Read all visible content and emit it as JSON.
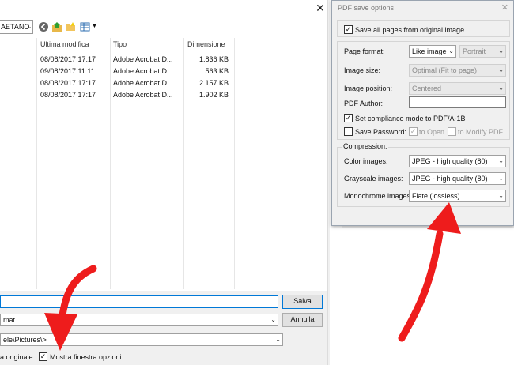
{
  "save_dialog": {
    "close_glyph": "✕",
    "look_in_value": "AETANO",
    "columns": [
      "Ultima modifica",
      "Tipo",
      "Dimensione"
    ],
    "files": [
      {
        "modified": "08/08/2017 17:17",
        "type": "Adobe Acrobat D...",
        "size": "1.836 KB"
      },
      {
        "modified": "09/08/2017 11:11",
        "type": "Adobe Acrobat D...",
        "size": "563 KB"
      },
      {
        "modified": "08/08/2017 17:17",
        "type": "Adobe Acrobat D...",
        "size": "2.157 KB"
      },
      {
        "modified": "08/08/2017 17:17",
        "type": "Adobe Acrobat D...",
        "size": "1.902 KB"
      }
    ],
    "filename_value": "",
    "save_label": "Salva",
    "format_value": "mat",
    "cancel_label": "Annulla",
    "folder_value": "ele\\Pictures\\>",
    "keep_original_label": "a originale",
    "show_options_label": "Mostra finestra opzioni",
    "show_options_checked": true
  },
  "pdf_options": {
    "title": "PDF save options",
    "save_all_pages_label": "Save all pages from original image",
    "save_all_pages_checked": true,
    "page_format_label": "Page format:",
    "page_format_value": "Like image",
    "orientation_value": "Portrait",
    "image_size_label": "Image size:",
    "image_size_value": "Optimal (Fit to page)",
    "image_position_label": "Image position:",
    "image_position_value": "Centered",
    "pdf_author_label": "PDF Author:",
    "pdf_author_value": "",
    "compliance_label": "Set compliance mode to PDF/A-1B",
    "compliance_checked": true,
    "save_password_label": "Save Password:",
    "save_password_checked": false,
    "to_open_label": "to Open",
    "to_modify_label": "to Modify",
    "pdf_suffix": "PDF",
    "compression_label": "Compression:",
    "color_images_label": "Color images:",
    "color_images_value": "JPEG - high quality (80)",
    "grayscale_images_label": "Grayscale images:",
    "grayscale_images_value": "JPEG - high quality (80)",
    "monochrome_images_label": "Monochrome images:",
    "monochrome_images_value": "Flate (lossless)"
  },
  "colors": {
    "arrow": "#ee1c1c",
    "accent": "#0078d7"
  }
}
